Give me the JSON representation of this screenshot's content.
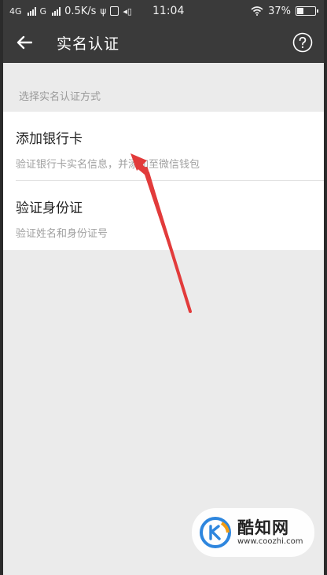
{
  "status_bar": {
    "network_1": "4G",
    "network_2": "G",
    "speed": "0.5K/s",
    "time": "11:04",
    "battery": "37%"
  },
  "header": {
    "title": "实名认证",
    "back_icon": "arrow-left-icon",
    "help_icon": "question-circle-icon"
  },
  "main": {
    "section_label": "选择实名认证方式",
    "options": [
      {
        "title": "添加银行卡",
        "description": "验证银行卡实名信息，并添加至微信钱包"
      },
      {
        "title": "验证身份证",
        "description": "验证姓名和身份证号"
      }
    ]
  },
  "annotation": {
    "color": "#e23b3b"
  },
  "watermark": {
    "name": "酷知网",
    "url": "www.coozhi.com"
  },
  "colors": {
    "bar": "#3a3a3a",
    "background": "#ebebeb",
    "card": "#ffffff"
  }
}
